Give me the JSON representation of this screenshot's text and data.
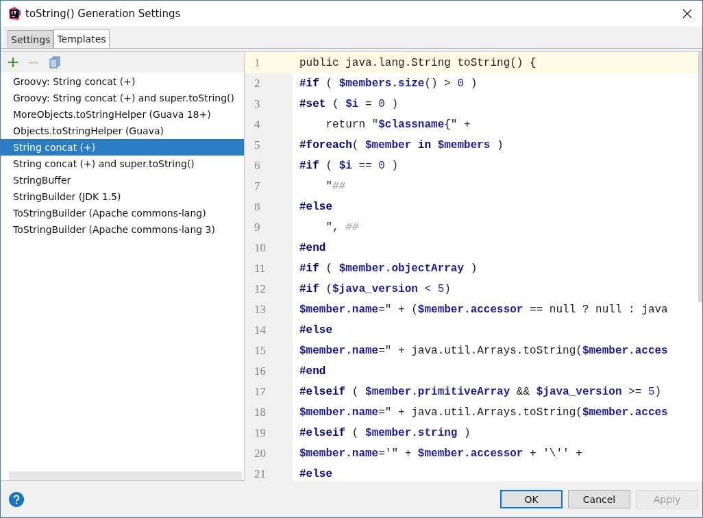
{
  "window": {
    "title": "toString() Generation Settings"
  },
  "tabs": [
    {
      "label": "Settings",
      "selected": false
    },
    {
      "label": "Templates",
      "selected": true
    }
  ],
  "toolbar": {
    "add": {
      "disabled": false
    },
    "remove": {
      "disabled": true
    },
    "copy": {
      "disabled": false
    }
  },
  "templates": [
    {
      "label": "Groovy: String concat (+)",
      "selected": false
    },
    {
      "label": "Groovy: String concat (+) and super.toString()",
      "selected": false
    },
    {
      "label": "MoreObjects.toStringHelper (Guava 18+)",
      "selected": false
    },
    {
      "label": "Objects.toStringHelper (Guava)",
      "selected": false
    },
    {
      "label": "String concat (+)",
      "selected": true
    },
    {
      "label": "String concat (+) and super.toString()",
      "selected": false
    },
    {
      "label": "StringBuffer",
      "selected": false
    },
    {
      "label": "StringBuilder (JDK 1.5)",
      "selected": false
    },
    {
      "label": "ToStringBuilder (Apache commons-lang)",
      "selected": false
    },
    {
      "label": "ToStringBuilder (Apache commons-lang 3)",
      "selected": false
    }
  ],
  "editor": {
    "lines": [
      {
        "number": "1",
        "current": true,
        "tokens": [
          {
            "kind": "plain",
            "text": "public java.lang.String toString() {"
          }
        ]
      },
      {
        "number": "2",
        "current": false,
        "tokens": [
          {
            "kind": "directive",
            "text": "#if"
          },
          {
            "kind": "plain",
            "text": " ( "
          },
          {
            "kind": "var",
            "text": "$members.size"
          },
          {
            "kind": "plain",
            "text": "() > "
          },
          {
            "kind": "number",
            "text": "0"
          },
          {
            "kind": "plain",
            "text": " )"
          }
        ]
      },
      {
        "number": "3",
        "current": false,
        "tokens": [
          {
            "kind": "directive",
            "text": "#set"
          },
          {
            "kind": "plain",
            "text": " ( "
          },
          {
            "kind": "var",
            "text": "$i"
          },
          {
            "kind": "plain",
            "text": " = "
          },
          {
            "kind": "number",
            "text": "0"
          },
          {
            "kind": "plain",
            "text": " )"
          }
        ]
      },
      {
        "number": "4",
        "current": false,
        "tokens": [
          {
            "kind": "plain",
            "text": "    return \""
          },
          {
            "kind": "var",
            "text": "$classname"
          },
          {
            "kind": "plain",
            "text": "{\" +"
          }
        ]
      },
      {
        "number": "5",
        "current": false,
        "tokens": [
          {
            "kind": "directive",
            "text": "#foreach"
          },
          {
            "kind": "plain",
            "text": "( "
          },
          {
            "kind": "var",
            "text": "$member"
          },
          {
            "kind": "directive",
            "text": " in "
          },
          {
            "kind": "var",
            "text": "$members"
          },
          {
            "kind": "plain",
            "text": " )"
          }
        ]
      },
      {
        "number": "6",
        "current": false,
        "tokens": [
          {
            "kind": "directive",
            "text": "#if"
          },
          {
            "kind": "plain",
            "text": " ( "
          },
          {
            "kind": "var",
            "text": "$i"
          },
          {
            "kind": "plain",
            "text": " == "
          },
          {
            "kind": "number",
            "text": "0"
          },
          {
            "kind": "plain",
            "text": " )"
          }
        ]
      },
      {
        "number": "7",
        "current": false,
        "tokens": [
          {
            "kind": "plain",
            "text": "    \""
          },
          {
            "kind": "comment",
            "text": "##"
          }
        ]
      },
      {
        "number": "8",
        "current": false,
        "tokens": [
          {
            "kind": "directive",
            "text": "#else"
          }
        ]
      },
      {
        "number": "9",
        "current": false,
        "tokens": [
          {
            "kind": "plain",
            "text": "    \", "
          },
          {
            "kind": "comment",
            "text": "##"
          }
        ]
      },
      {
        "number": "10",
        "current": false,
        "tokens": [
          {
            "kind": "directive",
            "text": "#end"
          }
        ]
      },
      {
        "number": "11",
        "current": false,
        "tokens": [
          {
            "kind": "directive",
            "text": "#if"
          },
          {
            "kind": "plain",
            "text": " ( "
          },
          {
            "kind": "var",
            "text": "$member.objectArray"
          },
          {
            "kind": "plain",
            "text": " )"
          }
        ]
      },
      {
        "number": "12",
        "current": false,
        "tokens": [
          {
            "kind": "directive",
            "text": "#if"
          },
          {
            "kind": "plain",
            "text": " ("
          },
          {
            "kind": "var",
            "text": "$java_version"
          },
          {
            "kind": "plain",
            "text": " < "
          },
          {
            "kind": "number",
            "text": "5"
          },
          {
            "kind": "plain",
            "text": ")"
          }
        ]
      },
      {
        "number": "13",
        "current": false,
        "tokens": [
          {
            "kind": "var",
            "text": "$member.name"
          },
          {
            "kind": "plain",
            "text": "=\" + ("
          },
          {
            "kind": "var",
            "text": "$member.accessor"
          },
          {
            "kind": "plain",
            "text": " == null ? null : java"
          }
        ]
      },
      {
        "number": "14",
        "current": false,
        "tokens": [
          {
            "kind": "directive",
            "text": "#else"
          }
        ]
      },
      {
        "number": "15",
        "current": false,
        "tokens": [
          {
            "kind": "var",
            "text": "$member.name"
          },
          {
            "kind": "plain",
            "text": "=\" + java.util.Arrays.toString("
          },
          {
            "kind": "var",
            "text": "$member.acces"
          }
        ]
      },
      {
        "number": "16",
        "current": false,
        "tokens": [
          {
            "kind": "directive",
            "text": "#end"
          }
        ]
      },
      {
        "number": "17",
        "current": false,
        "tokens": [
          {
            "kind": "directive",
            "text": "#elseif"
          },
          {
            "kind": "plain",
            "text": " ( "
          },
          {
            "kind": "var",
            "text": "$member.primitiveArray"
          },
          {
            "kind": "plain",
            "text": " && "
          },
          {
            "kind": "var",
            "text": "$java_version"
          },
          {
            "kind": "plain",
            "text": " >= "
          },
          {
            "kind": "number",
            "text": "5"
          },
          {
            "kind": "plain",
            "text": ")"
          }
        ]
      },
      {
        "number": "18",
        "current": false,
        "tokens": [
          {
            "kind": "var",
            "text": "$member.name"
          },
          {
            "kind": "plain",
            "text": "=\" + java.util.Arrays.toString("
          },
          {
            "kind": "var",
            "text": "$member.acces"
          }
        ]
      },
      {
        "number": "19",
        "current": false,
        "tokens": [
          {
            "kind": "directive",
            "text": "#elseif"
          },
          {
            "kind": "plain",
            "text": " ( "
          },
          {
            "kind": "var",
            "text": "$member.string"
          },
          {
            "kind": "plain",
            "text": " )"
          }
        ]
      },
      {
        "number": "20",
        "current": false,
        "tokens": [
          {
            "kind": "var",
            "text": "$member.name"
          },
          {
            "kind": "plain",
            "text": "='\" + "
          },
          {
            "kind": "var",
            "text": "$member.accessor"
          },
          {
            "kind": "plain",
            "text": " + '\\'' +"
          }
        ]
      },
      {
        "number": "21",
        "current": false,
        "tokens": [
          {
            "kind": "directive",
            "text": "#else"
          }
        ]
      }
    ]
  },
  "buttons": [
    {
      "label": "OK",
      "kind": "default",
      "disabled": false
    },
    {
      "label": "Cancel",
      "kind": "normal",
      "disabled": false
    },
    {
      "label": "Apply",
      "kind": "normal",
      "disabled": true
    }
  ]
}
